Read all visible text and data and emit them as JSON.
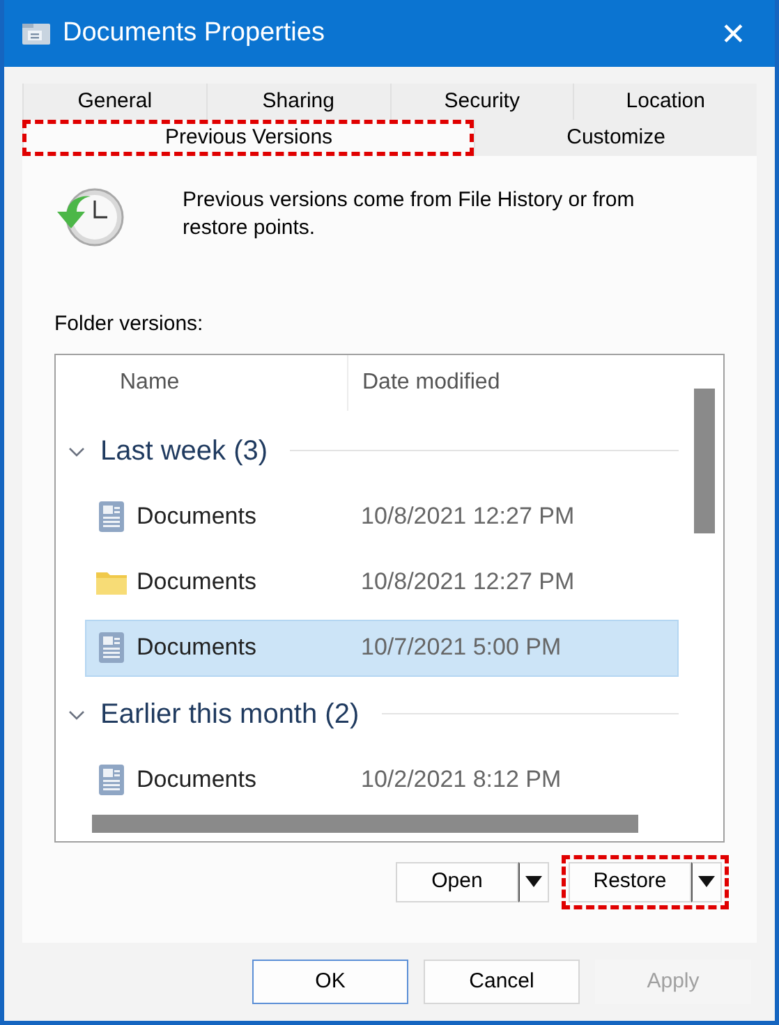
{
  "window": {
    "title": "Documents Properties",
    "close": "✕"
  },
  "tab_rows": [
    [
      {
        "label": "General",
        "selected": false,
        "highlighted": false
      },
      {
        "label": "Sharing",
        "selected": false,
        "highlighted": false
      },
      {
        "label": "Security",
        "selected": false,
        "highlighted": false
      },
      {
        "label": "Location",
        "selected": false,
        "highlighted": false
      }
    ],
    [
      {
        "label": "Previous Versions",
        "selected": true,
        "highlighted": true
      },
      {
        "label": "Customize",
        "selected": false,
        "highlighted": false
      }
    ]
  ],
  "description": "Previous versions come from File History or from restore points.",
  "list_label": "Folder versions:",
  "columns": [
    "Name",
    "Date modified"
  ],
  "groups": [
    {
      "label": "Last week (3)",
      "expanded": true,
      "items": [
        {
          "name": "Documents",
          "date": "10/8/2021 12:27 PM",
          "kind": "document",
          "selected": false
        },
        {
          "name": "Documents",
          "date": "10/8/2021 12:27 PM",
          "kind": "folder",
          "selected": false
        },
        {
          "name": "Documents",
          "date": "10/7/2021 5:00 PM",
          "kind": "document",
          "selected": true
        }
      ]
    },
    {
      "label": "Earlier this month (2)",
      "expanded": true,
      "items": [
        {
          "name": "Documents",
          "date": "10/2/2021 8:12 PM",
          "kind": "document",
          "selected": false
        }
      ]
    }
  ],
  "split_buttons": [
    {
      "label": "Open",
      "highlighted": false
    },
    {
      "label": "Restore",
      "highlighted": true
    }
  ],
  "buttons": [
    {
      "label": "OK",
      "default": true,
      "disabled": false
    },
    {
      "label": "Cancel",
      "default": false,
      "disabled": false
    },
    {
      "label": "Apply",
      "default": false,
      "disabled": true
    }
  ]
}
